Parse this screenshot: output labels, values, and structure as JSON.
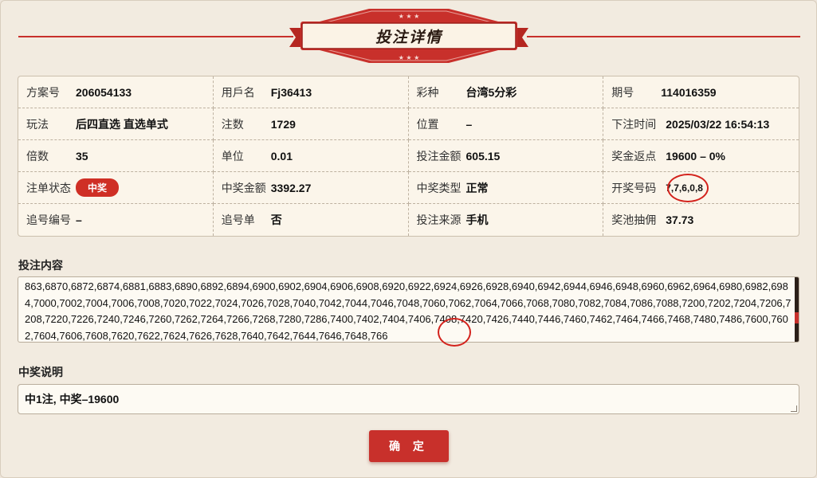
{
  "header": {
    "title": "投注详情"
  },
  "info": {
    "plan_no": {
      "label": "方案号",
      "value": "206054133"
    },
    "username": {
      "label": "用戶名",
      "value": "Fj36413"
    },
    "lottery": {
      "label": "彩种",
      "value": "台湾5分彩"
    },
    "period": {
      "label": "期号",
      "value": "114016359"
    },
    "play": {
      "label": "玩法",
      "value": "后四直选 直选单式"
    },
    "bets": {
      "label": "注数",
      "value": "1729"
    },
    "position": {
      "label": "位置",
      "value": "–"
    },
    "bet_time": {
      "label": "下注时间",
      "value": "2025/03/22 16:54:13"
    },
    "multiple": {
      "label": "倍数",
      "value": "35"
    },
    "unit": {
      "label": "单位",
      "value": "0.01"
    },
    "bet_amount": {
      "label": "投注金额",
      "value": "605.15"
    },
    "rebate": {
      "label": "奖金返点",
      "value": "19600 – 0%"
    },
    "status": {
      "label": "注单状态",
      "value": "中奖"
    },
    "win_amount": {
      "label": "中奖金额",
      "value": "3392.27"
    },
    "win_type": {
      "label": "中奖类型",
      "value": "正常"
    },
    "draw_number": {
      "label": "开奖号码",
      "value": "7,7,6,0,8"
    },
    "chase_no": {
      "label": "追号编号",
      "value": "–"
    },
    "chase": {
      "label": "追号单",
      "value": "否"
    },
    "source": {
      "label": "投注来源",
      "value": "手机"
    },
    "pool": {
      "label": "奖池抽佣",
      "value": "37.73"
    }
  },
  "bet_content": {
    "label": "投注内容",
    "text": "863,6870,6872,6874,6881,6883,6890,6892,6894,6900,6902,6904,6906,6908,6920,6922,6924,6926,6928,6940,6942,6944,6946,6948,6960,6962,6964,6980,6982,6984,7000,7002,7004,7006,7008,7020,7022,7024,7026,7028,7040,7042,7044,7046,7048,7060,7062,7064,7066,7068,7080,7082,7084,7086,7088,7200,7202,7204,7206,7208,7220,7226,7240,7246,7260,7262,7264,7266,7268,7280,7286,7400,7402,7404,7406,7408,7420,7426,7440,7446,7460,7462,7464,7466,7468,7480,7486,7600,7602,7604,7606,7608,7620,7622,7624,7626,7628,7640,7642,7644,7646,7648,766"
  },
  "win_note": {
    "label": "中奖说明",
    "text": "中1注, 中奖–19600"
  },
  "confirm_label": "确 定",
  "colors": {
    "accent": "#c8302b",
    "panel": "#fbf5ea",
    "background": "#f2ebe0"
  }
}
